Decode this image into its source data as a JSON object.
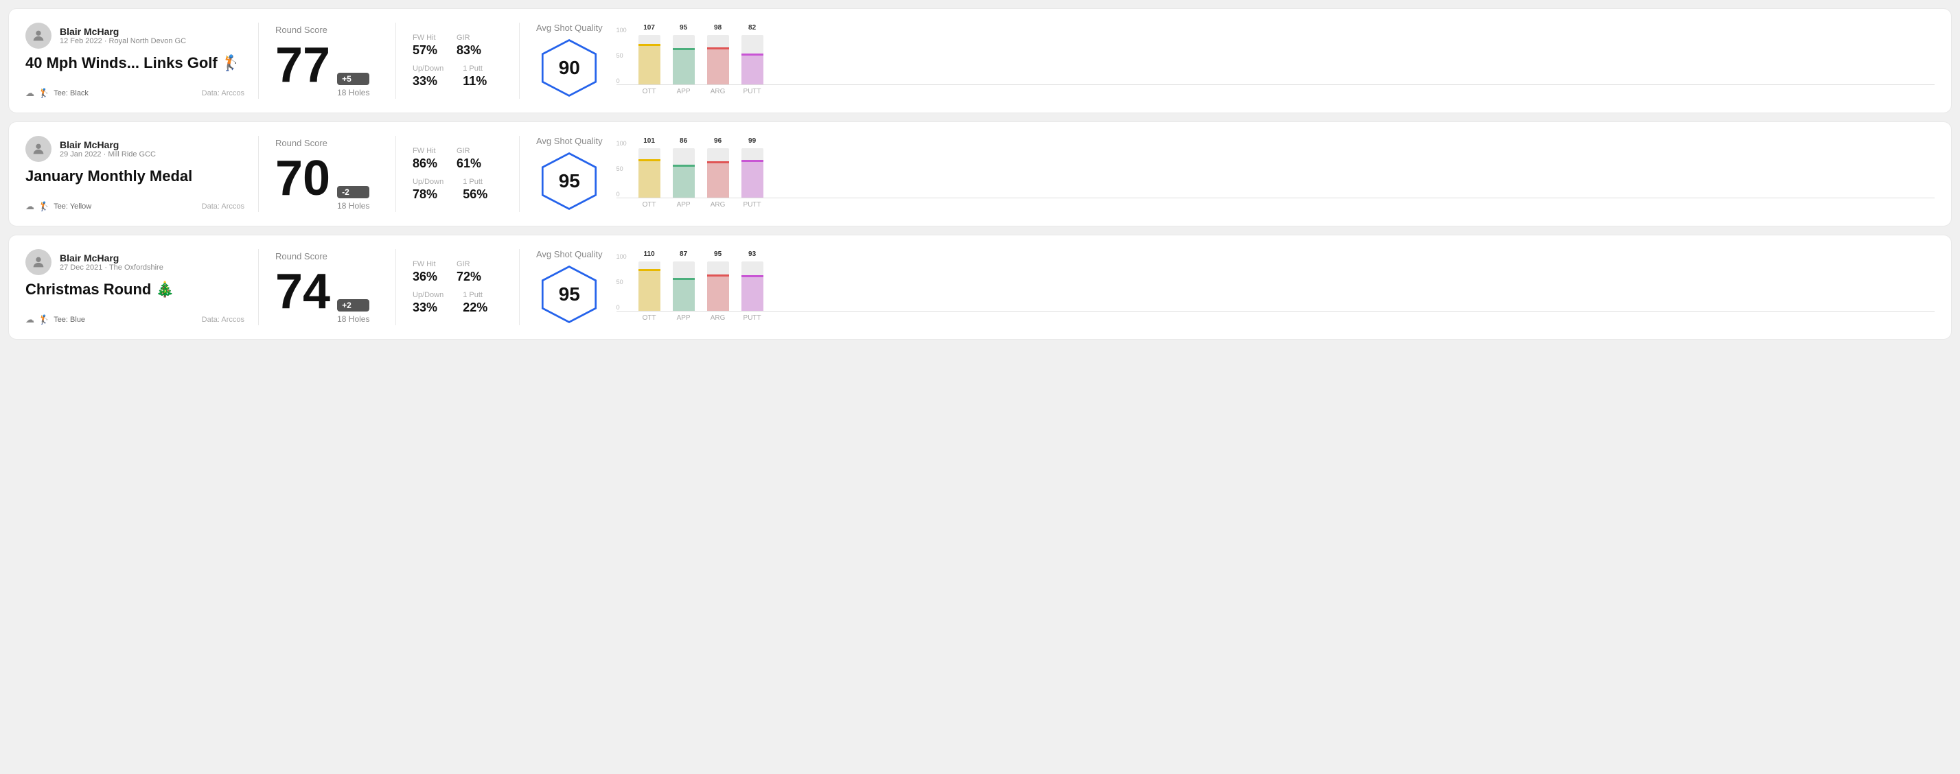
{
  "rounds": [
    {
      "user": "Blair McHarg",
      "date": "12 Feb 2022 · Royal North Devon GC",
      "title": "40 Mph Winds... Links Golf 🏌️",
      "tee": "Black",
      "dataSource": "Data: Arccos",
      "roundScore": "77",
      "scoreDiff": "+5",
      "scoreDiffType": "positive",
      "holes": "18 Holes",
      "fwHit": "57%",
      "gir": "83%",
      "upDown": "33%",
      "onePutt": "11%",
      "avgShotQuality": "90",
      "chartBars": [
        {
          "label": "OTT",
          "value": 107,
          "color": "#e8b800",
          "maxVal": 130
        },
        {
          "label": "APP",
          "value": 95,
          "color": "#4caf7d",
          "maxVal": 130
        },
        {
          "label": "ARG",
          "value": 98,
          "color": "#e05555",
          "maxVal": 130
        },
        {
          "label": "PUTT",
          "value": 82,
          "color": "#c855d4",
          "maxVal": 130
        }
      ]
    },
    {
      "user": "Blair McHarg",
      "date": "29 Jan 2022 · Mill Ride GCC",
      "title": "January Monthly Medal",
      "tee": "Yellow",
      "dataSource": "Data: Arccos",
      "roundScore": "70",
      "scoreDiff": "-2",
      "scoreDiffType": "negative",
      "holes": "18 Holes",
      "fwHit": "86%",
      "gir": "61%",
      "upDown": "78%",
      "onePutt": "56%",
      "avgShotQuality": "95",
      "chartBars": [
        {
          "label": "OTT",
          "value": 101,
          "color": "#e8b800",
          "maxVal": 130
        },
        {
          "label": "APP",
          "value": 86,
          "color": "#4caf7d",
          "maxVal": 130
        },
        {
          "label": "ARG",
          "value": 96,
          "color": "#e05555",
          "maxVal": 130
        },
        {
          "label": "PUTT",
          "value": 99,
          "color": "#c855d4",
          "maxVal": 130
        }
      ]
    },
    {
      "user": "Blair McHarg",
      "date": "27 Dec 2021 · The Oxfordshire",
      "title": "Christmas Round 🎄",
      "tee": "Blue",
      "dataSource": "Data: Arccos",
      "roundScore": "74",
      "scoreDiff": "+2",
      "scoreDiffType": "positive",
      "holes": "18 Holes",
      "fwHit": "36%",
      "gir": "72%",
      "upDown": "33%",
      "onePutt": "22%",
      "avgShotQuality": "95",
      "chartBars": [
        {
          "label": "OTT",
          "value": 110,
          "color": "#e8b800",
          "maxVal": 130
        },
        {
          "label": "APP",
          "value": 87,
          "color": "#4caf7d",
          "maxVal": 130
        },
        {
          "label": "ARG",
          "value": 95,
          "color": "#e05555",
          "maxVal": 130
        },
        {
          "label": "PUTT",
          "value": 93,
          "color": "#c855d4",
          "maxVal": 130
        }
      ]
    }
  ],
  "labels": {
    "roundScore": "Round Score",
    "fwHit": "FW Hit",
    "gir": "GIR",
    "upDown": "Up/Down",
    "onePutt": "1 Putt",
    "avgShotQuality": "Avg Shot Quality",
    "teePrefix": "Tee:"
  }
}
